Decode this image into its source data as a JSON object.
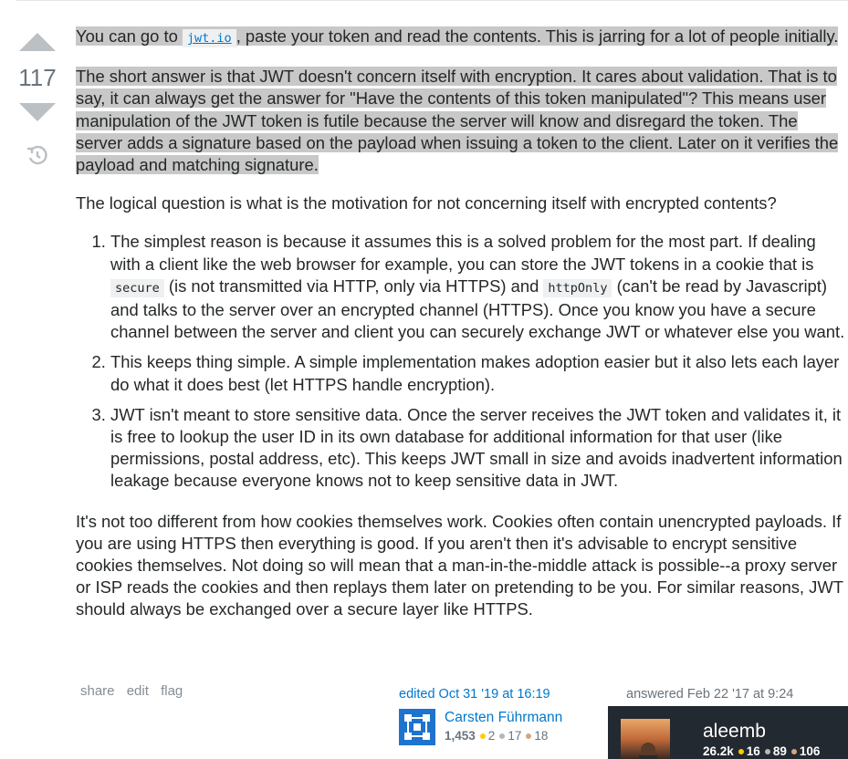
{
  "vote": {
    "count": "117"
  },
  "paragraphs": {
    "p1_pre": "You can go to ",
    "p1_link": "jwt.io",
    "p1_post": ", paste your token and read the contents. This is jarring for a lot of people initially.",
    "p2": "The short answer is that JWT doesn't concern itself with encryption. It cares about validation. That is to say, it can always get the answer for \"Have the contents of this token manipulated\"? This means user manipulation of the JWT token is futile because the server will know and disregard the token. The server adds a signature based on the payload when issuing a token to the client. Later on it verifies the payload and matching signature.",
    "p3": "The logical question is what is the motivation for not concerning itself with encrypted contents?",
    "p4": "It's not too different from how cookies themselves work. Cookies often contain unencrypted payloads. If you are using HTTPS then everything is good. If you aren't then it's advisable to encrypt sensitive cookies themselves. Not doing so will mean that a man-in-the-middle attack is possible--a proxy server or ISP reads the cookies and then replays them later on pretending to be you. For similar reasons, JWT should always be exchanged over a secure layer like HTTPS."
  },
  "list": {
    "item1_a": "The simplest reason is because it assumes this is a solved problem for the most part. If dealing with a client like the web browser for example, you can store the JWT tokens in a cookie that is ",
    "item1_code1": "secure",
    "item1_b": " (is not transmitted via HTTP, only via HTTPS) and ",
    "item1_code2": "httpOnly",
    "item1_c": " (can't be read by Javascript) and talks to the server over an encrypted channel (HTTPS). Once you know you have a secure channel between the server and client you can securely exchange JWT or whatever else you want.",
    "item2": "This keeps thing simple. A simple implementation makes adoption easier but it also lets each layer do what it does best (let HTTPS handle encryption).",
    "item3": "JWT isn't meant to store sensitive data. Once the server receives the JWT token and validates it, it is free to lookup the user ID in its own database for additional information for that user (like permissions, postal address, etc). This keeps JWT small in size and avoids inadvertent information leakage because everyone knows not to keep sensitive data in JWT."
  },
  "menu": {
    "share": "share",
    "edit": "edit",
    "flag": "flag"
  },
  "edited": {
    "label": "edited Oct 31 '19 at 16:19",
    "user": "Carsten Führmann",
    "rep": "1,453",
    "gold": "2",
    "silver": "17",
    "bronze": "18"
  },
  "answered": {
    "label": "answered Feb 22 '17 at 9:24",
    "user": "aleemb",
    "rep": "26.2k",
    "gold": "16",
    "silver": "89",
    "bronze": "106"
  },
  "colors": {
    "link": "#0077cc",
    "highlight": "#c8c8c8",
    "vote_arrow": "#bbc0c4",
    "card": "#232931"
  }
}
